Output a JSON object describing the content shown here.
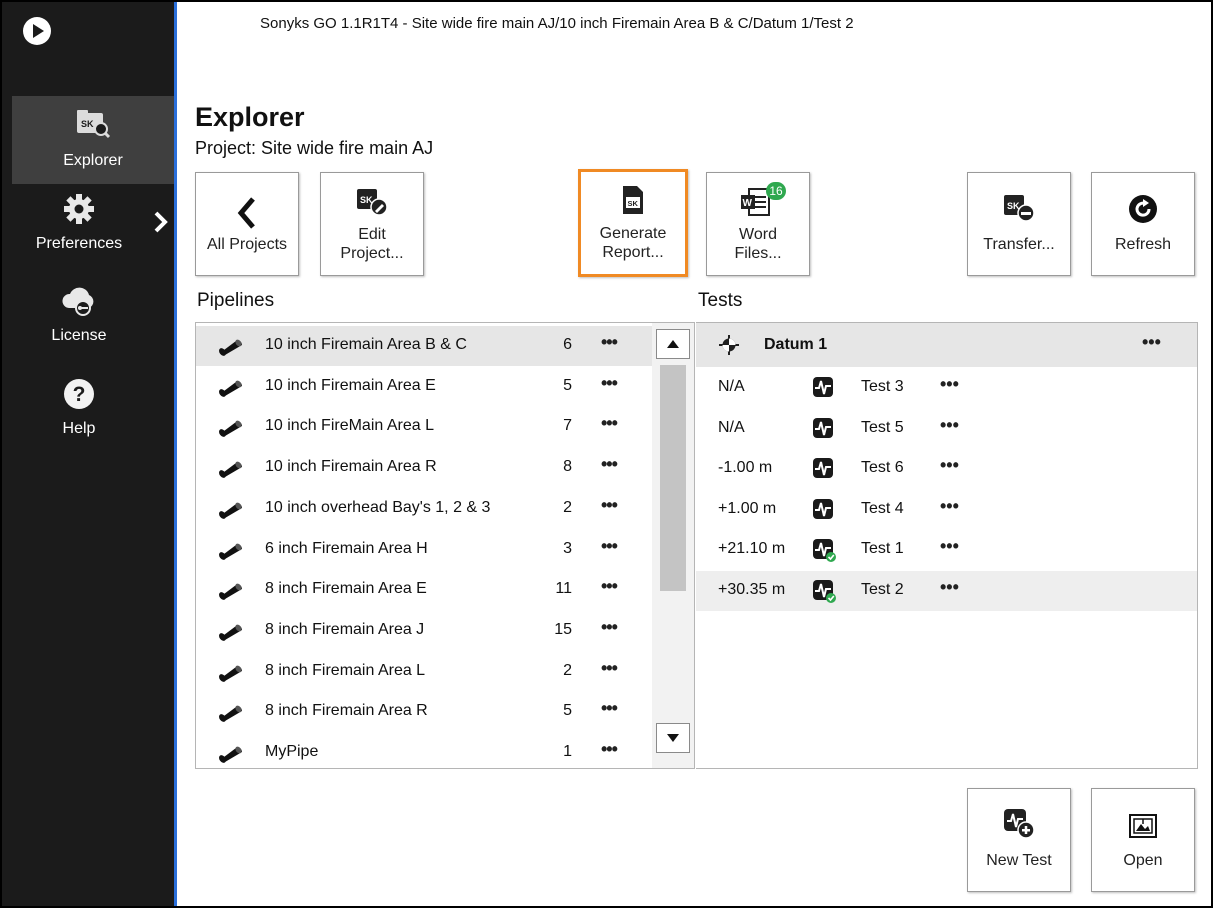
{
  "window": {
    "title": "Sonyks GO 1.1R1T4 - Site wide fire main AJ/10 inch Firemain Area B & C/Datum 1/Test 2"
  },
  "sidebar": {
    "items": [
      {
        "label": "Explorer",
        "icon": "explorer-icon",
        "selected": true
      },
      {
        "label": "Preferences",
        "icon": "gear-icon"
      },
      {
        "label": "License",
        "icon": "license-icon"
      },
      {
        "label": "Help",
        "icon": "help-icon"
      }
    ]
  },
  "header": {
    "title": "Explorer",
    "project": "Project: Site wide fire main AJ"
  },
  "toolbar": {
    "all_projects": "All Projects",
    "edit_project_1": "Edit",
    "edit_project_2": "Project...",
    "generate_report_1": "Generate",
    "generate_report_2": "Report...",
    "word_files_1": "Word",
    "word_files_2": "Files...",
    "word_badge": "16",
    "transfer": "Transfer...",
    "refresh": "Refresh",
    "new_test": "New Test",
    "open": "Open"
  },
  "pipelines": {
    "heading": "Pipelines",
    "items": [
      {
        "name": "10 inch Firemain Area B & C",
        "count": "6"
      },
      {
        "name": "10 inch Firemain Area E",
        "count": "5"
      },
      {
        "name": "10 inch FireMain Area L",
        "count": "7"
      },
      {
        "name": "10 inch Firemain Area R",
        "count": "8"
      },
      {
        "name": "10 inch overhead Bay's 1, 2 & 3",
        "count": "2"
      },
      {
        "name": "6 inch Firemain Area H",
        "count": "3"
      },
      {
        "name": "8 inch Firemain Area E",
        "count": "11"
      },
      {
        "name": "8 inch Firemain Area J",
        "count": "15"
      },
      {
        "name": "8 inch Firemain Area L",
        "count": "2"
      },
      {
        "name": "8 inch Firemain Area R",
        "count": "5"
      },
      {
        "name": "MyPipe",
        "count": "1"
      }
    ],
    "more": "•••"
  },
  "tests": {
    "heading": "Tests",
    "datum": "Datum 1",
    "items": [
      {
        "distance": "N/A",
        "name": "Test 3",
        "checked": false
      },
      {
        "distance": "N/A",
        "name": "Test 5",
        "checked": false
      },
      {
        "distance": "-1.00 m",
        "name": "Test 6",
        "checked": false
      },
      {
        "distance": "+1.00 m",
        "name": "Test 4",
        "checked": false
      },
      {
        "distance": "+21.10 m",
        "name": "Test 1",
        "checked": true
      },
      {
        "distance": "+30.35 m",
        "name": "Test 2",
        "checked": true
      }
    ]
  },
  "colors": {
    "sidebar": "#1b1b1b",
    "accent_blue": "#2a6fdb",
    "highlight_orange": "#f08a24",
    "badge_green": "#2fa84f"
  }
}
